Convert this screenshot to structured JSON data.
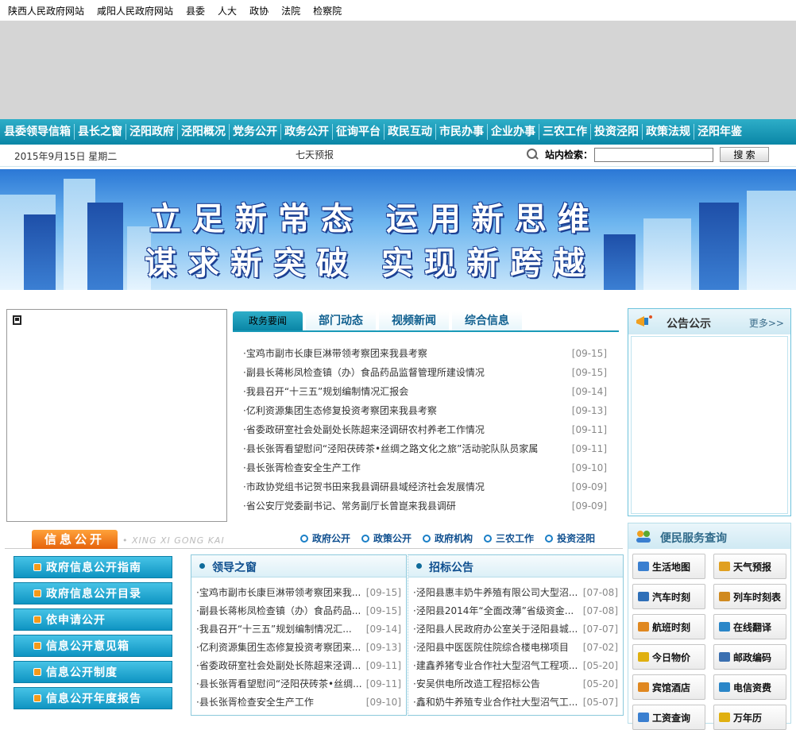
{
  "top_links": [
    "陕西人民政府网站",
    "咸阳人民政府网站",
    "县委",
    "人大",
    "政协",
    "法院",
    "检察院"
  ],
  "main_nav": [
    "县委领导信箱",
    "县长之窗",
    "泾阳政府",
    "泾阳概况",
    "党务公开",
    "政务公开",
    "征询平台",
    "政民互动",
    "市民办事",
    "企业办事",
    "三农工作",
    "投资泾阳",
    "政策法规",
    "泾阳年鉴"
  ],
  "sub_bar": {
    "date": "2015年9月15日  星期二",
    "weather": "七天预报",
    "search_label": "站内检索：",
    "search_value": "",
    "search_button": "搜 索"
  },
  "hero": {
    "line1": "立足新常态  运用新思维",
    "line2": "谋求新突破  实现新跨越"
  },
  "news_tabs": [
    "政务要闻",
    "部门动态",
    "视频新闻",
    "综合信息"
  ],
  "news": [
    {
      "title": "·宝鸡市副市长康巨淋带领考察团来我县考察",
      "date": "[09-15]"
    },
    {
      "title": "·副县长蒋彬凤检查镇（办）食品药品监督管理所建设情况",
      "date": "[09-15]"
    },
    {
      "title": "·我县召开“十三五”规划编制情况汇报会",
      "date": "[09-14]"
    },
    {
      "title": "·亿利资源集团生态修复投资考察团来我县考察",
      "date": "[09-13]"
    },
    {
      "title": "·省委政研室社会处副处长陈超来泾调研农村养老工作情况",
      "date": "[09-11]"
    },
    {
      "title": "·县长张胥看望慰问“泾阳茯砖茶•丝绸之路文化之旅”活动驼队队员家属",
      "date": "[09-11]"
    },
    {
      "title": "·县长张胥检查安全生产工作",
      "date": "[09-10]"
    },
    {
      "title": "·市政协党组书记贺书田来我县调研县域经济社会发展情况",
      "date": "[09-09]"
    },
    {
      "title": "·省公安厅党委副书记、常务副厅长曾崑来我县调研",
      "date": "[09-09]"
    }
  ],
  "notice": {
    "title": "公告公示",
    "more": "更多>>"
  },
  "info": {
    "badge": "信息公开",
    "pinyin": "• XING XI GONG  KAI",
    "links": [
      "政府公开",
      "政策公开",
      "政府机构",
      "三农工作",
      "投资泾阳"
    ]
  },
  "left_buttons": [
    "政府信息公开指南",
    "政府信息公开目录",
    "依申请公开",
    "信息公开意见箱",
    "信息公开制度",
    "信息公开年度报告"
  ],
  "lead": {
    "title": "领导之窗",
    "rows": [
      {
        "title": "·宝鸡市副市长康巨淋带领考察团来我...",
        "date": "[09-15]"
      },
      {
        "title": "·副县长蒋彬凤检查镇（办）食品药品...",
        "date": "[09-15]"
      },
      {
        "title": "·我县召开“十三五”规划编制情况汇...",
        "date": "[09-14]"
      },
      {
        "title": "·亿利资源集团生态修复投资考察团来...",
        "date": "[09-13]"
      },
      {
        "title": "·省委政研室社会处副处长陈超来泾调...",
        "date": "[09-11]"
      },
      {
        "title": "·县长张胥看望慰问“泾阳茯砖茶•丝绸...",
        "date": "[09-11]"
      },
      {
        "title": "·县长张胥检查安全生产工作",
        "date": "[09-10]"
      }
    ]
  },
  "bid": {
    "title": "招标公告",
    "rows": [
      {
        "title": "·泾阳县惠丰奶牛养殖有限公司大型沼...",
        "date": "[07-08]"
      },
      {
        "title": "·泾阳县2014年“全面改薄”省级资金...",
        "date": "[07-08]"
      },
      {
        "title": "·泾阳县人民政府办公室关于泾阳县城...",
        "date": "[07-07]"
      },
      {
        "title": "·泾阳县中医医院住院综合楼电梯项目",
        "date": "[07-02]"
      },
      {
        "title": "·建鑫养猪专业合作社大型沼气工程项...",
        "date": "[05-20]"
      },
      {
        "title": "·安吴供电所改造工程招标公告",
        "date": "[05-20]"
      },
      {
        "title": "·鑫和奶牛养殖专业合作社大型沼气工...",
        "date": "[05-07]"
      }
    ]
  },
  "services": {
    "title": "便民服务查询",
    "items": [
      {
        "label": "生活地图",
        "icon": "map-icon",
        "color": "#3a7fd0"
      },
      {
        "label": "天气预报",
        "icon": "weather-icon",
        "color": "#e0a020"
      },
      {
        "label": "汽车时刻",
        "icon": "bus-icon",
        "color": "#2f6fb8"
      },
      {
        "label": "列车时刻表",
        "icon": "train-icon",
        "color": "#d08a20"
      },
      {
        "label": "航班时刻",
        "icon": "plane-icon",
        "color": "#e08820"
      },
      {
        "label": "在线翻译",
        "icon": "translate-icon",
        "color": "#2a86c8"
      },
      {
        "label": "今日物价",
        "icon": "flag-icon",
        "color": "#e0b010"
      },
      {
        "label": "邮政编码",
        "icon": "mail-icon",
        "color": "#3a6fb0"
      },
      {
        "label": "宾馆酒店",
        "icon": "hotel-icon",
        "color": "#e08820"
      },
      {
        "label": "电信资费",
        "icon": "telecom-icon",
        "color": "#2a86c8"
      },
      {
        "label": "工资查询",
        "icon": "salary-icon",
        "color": "#3a7fd0"
      },
      {
        "label": "万年历",
        "icon": "calendar-icon",
        "color": "#e0b010"
      }
    ]
  }
}
